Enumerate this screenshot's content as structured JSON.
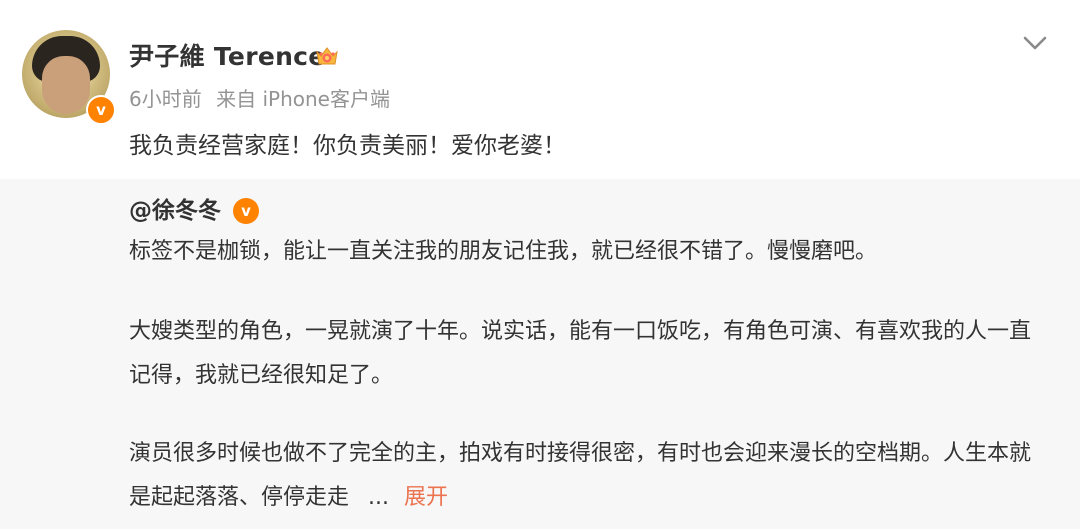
{
  "post": {
    "username": "尹子維 Terence",
    "time": "6小时前",
    "source": "来自 iPhone客户端",
    "text": "我负责经营家庭！你负责美丽！爱你老婆！"
  },
  "repost": {
    "mention": "@徐冬冬",
    "paragraphs": [
      "标签不是枷锁，能让一直关注我的朋友记住我，就已经很不错了。慢慢磨吧。",
      "大嫂类型的角色，一晃就演了十年。说实话，能有一口饭吃，有角色可演、有喜欢我的人一直记得，我就已经很知足了。",
      "演员很多时候也做不了完全的主，拍戏有时接得很密，有时也会迎来漫长的空档期。人生本就是起起落落、停停走走"
    ],
    "ellipsis": "...",
    "expand_label": "展开"
  },
  "icons": {
    "verify": "v",
    "verify_color": "#ff8200",
    "vip": "crown-vip-icon",
    "menu": "chevron-down-icon"
  },
  "colors": {
    "text": "#333333",
    "meta": "#939393",
    "repost_bg": "#f7f7f7",
    "link": "#eb7350"
  }
}
